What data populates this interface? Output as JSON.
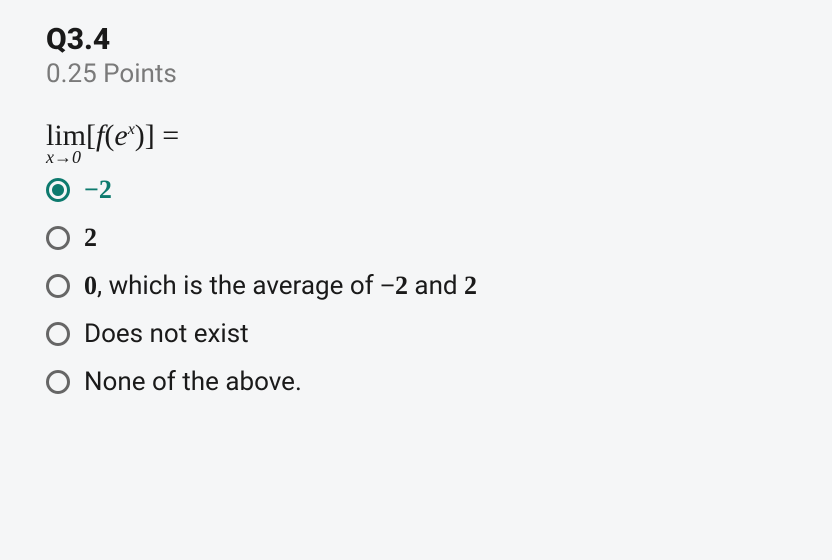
{
  "question": {
    "number": "Q3.4",
    "points": "0.25 Points",
    "equation": {
      "lim_top": "lim",
      "lim_sub": "x→0",
      "body": "[f(eˣ)] ="
    }
  },
  "options": [
    {
      "label_html": "<span class='math-inline'><span class='minus'>−</span>2</span>",
      "selected": true
    },
    {
      "label_html": "<span class='math-inline'>2</span>",
      "selected": false
    },
    {
      "label_html": "<span class='math-inline'>0</span>, which is the average of <span class='math-inline'><span class='minus'>−</span>2</span> and <span class='math-inline'>2</span>",
      "selected": false
    },
    {
      "label_html": "Does not exist",
      "selected": false
    },
    {
      "label_html": "None of the above.",
      "selected": false
    }
  ]
}
